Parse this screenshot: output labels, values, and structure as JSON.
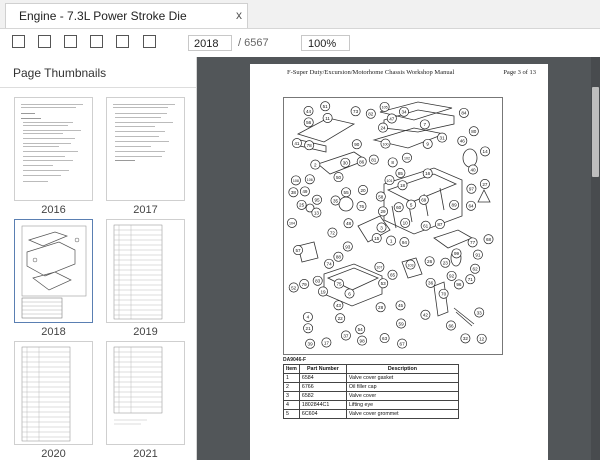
{
  "tab": {
    "title": "Engine - 7.3L Power Stroke Die",
    "close_glyph": "x"
  },
  "toolbar": {
    "button_icons": [
      "checkbox-square-icon",
      "checkbox-square-icon",
      "checkbox-square-icon",
      "checkbox-square-icon",
      "checkbox-square-icon",
      "checkbox-square-icon"
    ],
    "page_value": "2018",
    "page_total": "/ 6567",
    "zoom_value": "100%"
  },
  "sidebar": {
    "header": "Page Thumbnails",
    "thumbnails": [
      {
        "label": "2016"
      },
      {
        "label": "2017"
      },
      {
        "label": "2018",
        "selected": true
      },
      {
        "label": "2019"
      },
      {
        "label": "2020"
      },
      {
        "label": "2021"
      }
    ]
  },
  "document": {
    "header_left": "F-Super Duty/Excursion/Motorhome Chassis Workshop Manual",
    "header_right": "Page 3 of 13",
    "diagram_caption": "DA9046-F",
    "callouts": [
      "1",
      "2",
      "3",
      "4",
      "5",
      "6",
      "7",
      "8",
      "9",
      "10",
      "11",
      "12",
      "13",
      "14",
      "15",
      "16",
      "17",
      "18",
      "19",
      "20",
      "21",
      "22",
      "23",
      "24",
      "25",
      "26",
      "27",
      "28",
      "29",
      "30",
      "31",
      "32",
      "33",
      "34",
      "35",
      "36",
      "37",
      "38",
      "39",
      "40",
      "41",
      "42",
      "43",
      "44",
      "45",
      "46",
      "47",
      "48",
      "49",
      "50",
      "51",
      "52",
      "53",
      "54",
      "55",
      "56",
      "57",
      "58",
      "59",
      "60",
      "61",
      "62",
      "63",
      "64",
      "65",
      "66",
      "67",
      "68",
      "69",
      "70",
      "71",
      "72",
      "73",
      "74",
      "75",
      "76",
      "77",
      "78",
      "79",
      "80",
      "81",
      "82",
      "83",
      "84",
      "85",
      "86",
      "87",
      "88",
      "89",
      "90",
      "91",
      "92",
      "93",
      "94",
      "95",
      "96",
      "97",
      "98",
      "99",
      "100",
      "101",
      "102",
      "103",
      "104",
      "105",
      "106",
      "107",
      "108"
    ],
    "table": {
      "headers": [
        "Item",
        "Part Number",
        "Description"
      ],
      "rows": [
        [
          "1",
          "6584",
          "Valve cover gasket"
        ],
        [
          "2",
          "6766",
          "Oil filler cap"
        ],
        [
          "3",
          "6582",
          "Valve cover"
        ],
        [
          "4",
          "1802844C1",
          "Lifting eye"
        ],
        [
          "5",
          "6C604",
          "Valve cover grommet"
        ]
      ]
    }
  },
  "colors": {
    "viewer_bg": "#525659",
    "selected_border": "#5a7fb2"
  }
}
